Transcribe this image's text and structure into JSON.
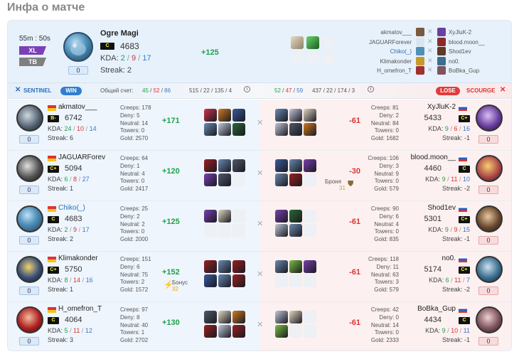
{
  "page": {
    "title": "Инфа о матче"
  },
  "summary": {
    "duration": "55m : 50s",
    "badge_xl": "XL",
    "badge_tb": "TB",
    "hero_name": "Ogre Magi",
    "rank": "C",
    "rating": "4683",
    "kda_label": "KDA:",
    "kills": "2",
    "deaths": "9",
    "assists": "17",
    "streak_label": "Streak: 2",
    "score": "0",
    "delta": "+125",
    "opponents": [
      {
        "left": "akmatov___",
        "right": "XyJluK-2"
      },
      {
        "left": "JAGUARForever",
        "right": "blood.moon__"
      },
      {
        "left": "Chiko(_)",
        "right": "Shod1ev"
      },
      {
        "left": "Klimakonder",
        "right": "no0."
      },
      {
        "left": "H_omefron_T",
        "right": "BoBka_Gup"
      }
    ]
  },
  "teams": {
    "sentinel_label": "SENTINEL",
    "win_label": "WIN",
    "total_label": "Общий счет:",
    "score_k": "45",
    "score_d": "52",
    "score_a": "86",
    "sentinel_extra": "515 / 22 / 135 / 4",
    "scourge_k": "52",
    "scourge_d": "47",
    "scourge_a": "59",
    "scourge_extra": "437 / 22 / 174 / 3",
    "lose_label": "LOSE",
    "scourge_label": "SCOURGE"
  },
  "left_players": [
    {
      "name": "akmatov___",
      "rank": "B-",
      "rating": "6742",
      "k": "24",
      "d": "10",
      "a": "14",
      "streak": "Streak: 6",
      "score": "0",
      "creeps": "Creeps: 178",
      "deny": "Deny: 5",
      "neutral": "Neutral: 14",
      "towers": "Towers: 0",
      "gold": "Gold: 2570",
      "delta": "+171",
      "extra_label": "",
      "extra_val": ""
    },
    {
      "name": "JAGUARForev",
      "rank": "C+",
      "rating": "5094",
      "k": "6",
      "d": "8",
      "a": "27",
      "streak": "Streak: 1",
      "score": "0",
      "creeps": "Creeps: 64",
      "deny": "Deny: 1",
      "neutral": "Neutral: 4",
      "towers": "Towers: 0",
      "gold": "Gold: 2417",
      "delta": "+120",
      "extra_label": "",
      "extra_val": ""
    },
    {
      "name": "Chiko(_)",
      "rank": "C",
      "rating": "4683",
      "k": "2",
      "d": "9",
      "a": "17",
      "streak": "Streak: 2",
      "score": "0",
      "creeps": "Creeps: 25",
      "deny": "Deny: 2",
      "neutral": "Neutral: 2",
      "towers": "Towers: 0",
      "gold": "Gold: 2000",
      "delta": "+125",
      "extra_label": "",
      "extra_val": ""
    },
    {
      "name": "Klimakonder",
      "rank": "C+",
      "rating": "5750",
      "k": "8",
      "d": "14",
      "a": "16",
      "streak": "Streak: 1",
      "score": "0",
      "creeps": "Creeps: 151",
      "deny": "Deny: 6",
      "neutral": "Neutral: 75",
      "towers": "Towers: 2",
      "gold": "Gold: 1572",
      "delta": "+152",
      "extra_label": "Бонус",
      "extra_val": "32"
    },
    {
      "name": "H_omefron_T",
      "rank": "C",
      "rating": "4064",
      "k": "5",
      "d": "11",
      "a": "12",
      "streak": "Streak: 3",
      "score": "0",
      "creeps": "Creeps: 97",
      "deny": "Deny: 8",
      "neutral": "Neutral: 40",
      "towers": "Towers: 1",
      "gold": "Gold: 2702",
      "delta": "+130",
      "extra_label": "",
      "extra_val": ""
    }
  ],
  "right_players": [
    {
      "name": "XyJluK-2",
      "rank": "C+",
      "rating": "5433",
      "k": "9",
      "d": "6",
      "a": "16",
      "streak": "Streak: -1",
      "score": "0",
      "creeps": "Creeps: 81",
      "deny": "Deny: 2",
      "neutral": "Neutral: 84",
      "towers": "Towers: 0",
      "gold": "Gold: 1682",
      "delta": "-61",
      "extra_label": "",
      "extra_val": ""
    },
    {
      "name": "blood.moon__",
      "rank": "C",
      "rating": "4460",
      "k": "9",
      "d": "11",
      "a": "10",
      "streak": "Streak: -2",
      "score": "0",
      "creeps": "Creeps: 106",
      "deny": "Deny: 3",
      "neutral": "Neutral: 9",
      "towers": "Towers: 0",
      "gold": "Gold: 579",
      "delta": "-30",
      "extra_label": "Броня",
      "extra_val": "31"
    },
    {
      "name": "Shod1ev",
      "rank": "C+",
      "rating": "5301",
      "k": "9",
      "d": "9",
      "a": "15",
      "streak": "Streak: -1",
      "score": "0",
      "creeps": "Creeps: 90",
      "deny": "Deny: 6",
      "neutral": "Neutral: 4",
      "towers": "Towers: 0",
      "gold": "Gold: 835",
      "delta": "-61",
      "extra_label": "",
      "extra_val": ""
    },
    {
      "name": "no0.",
      "rank": "C+",
      "rating": "5174",
      "k": "6",
      "d": "11",
      "a": "7",
      "streak": "Streak: -2",
      "score": "0",
      "creeps": "Creeps: 118",
      "deny": "Deny: 11",
      "neutral": "Neutral: 63",
      "towers": "Towers: 3",
      "gold": "Gold: 579",
      "delta": "-61",
      "extra_label": "",
      "extra_val": ""
    },
    {
      "name": "BoBka_Gup",
      "rank": "C",
      "rating": "4434",
      "k": "9",
      "d": "10",
      "a": "11",
      "streak": "Streak: -1",
      "score": "0",
      "creeps": "Creeps: 42",
      "deny": "Deny: 0",
      "neutral": "Neutral: 14",
      "towers": "Towers: 0",
      "gold": "Gold: 2333",
      "delta": "-61",
      "extra_label": "",
      "extra_val": ""
    }
  ],
  "colors": {
    "win": "#2f7fd1",
    "lose": "#e23b3b",
    "positive": "#21a04a",
    "negative": "#d33333",
    "sentinel": "#2c6fb8",
    "scourge": "#d33333"
  }
}
